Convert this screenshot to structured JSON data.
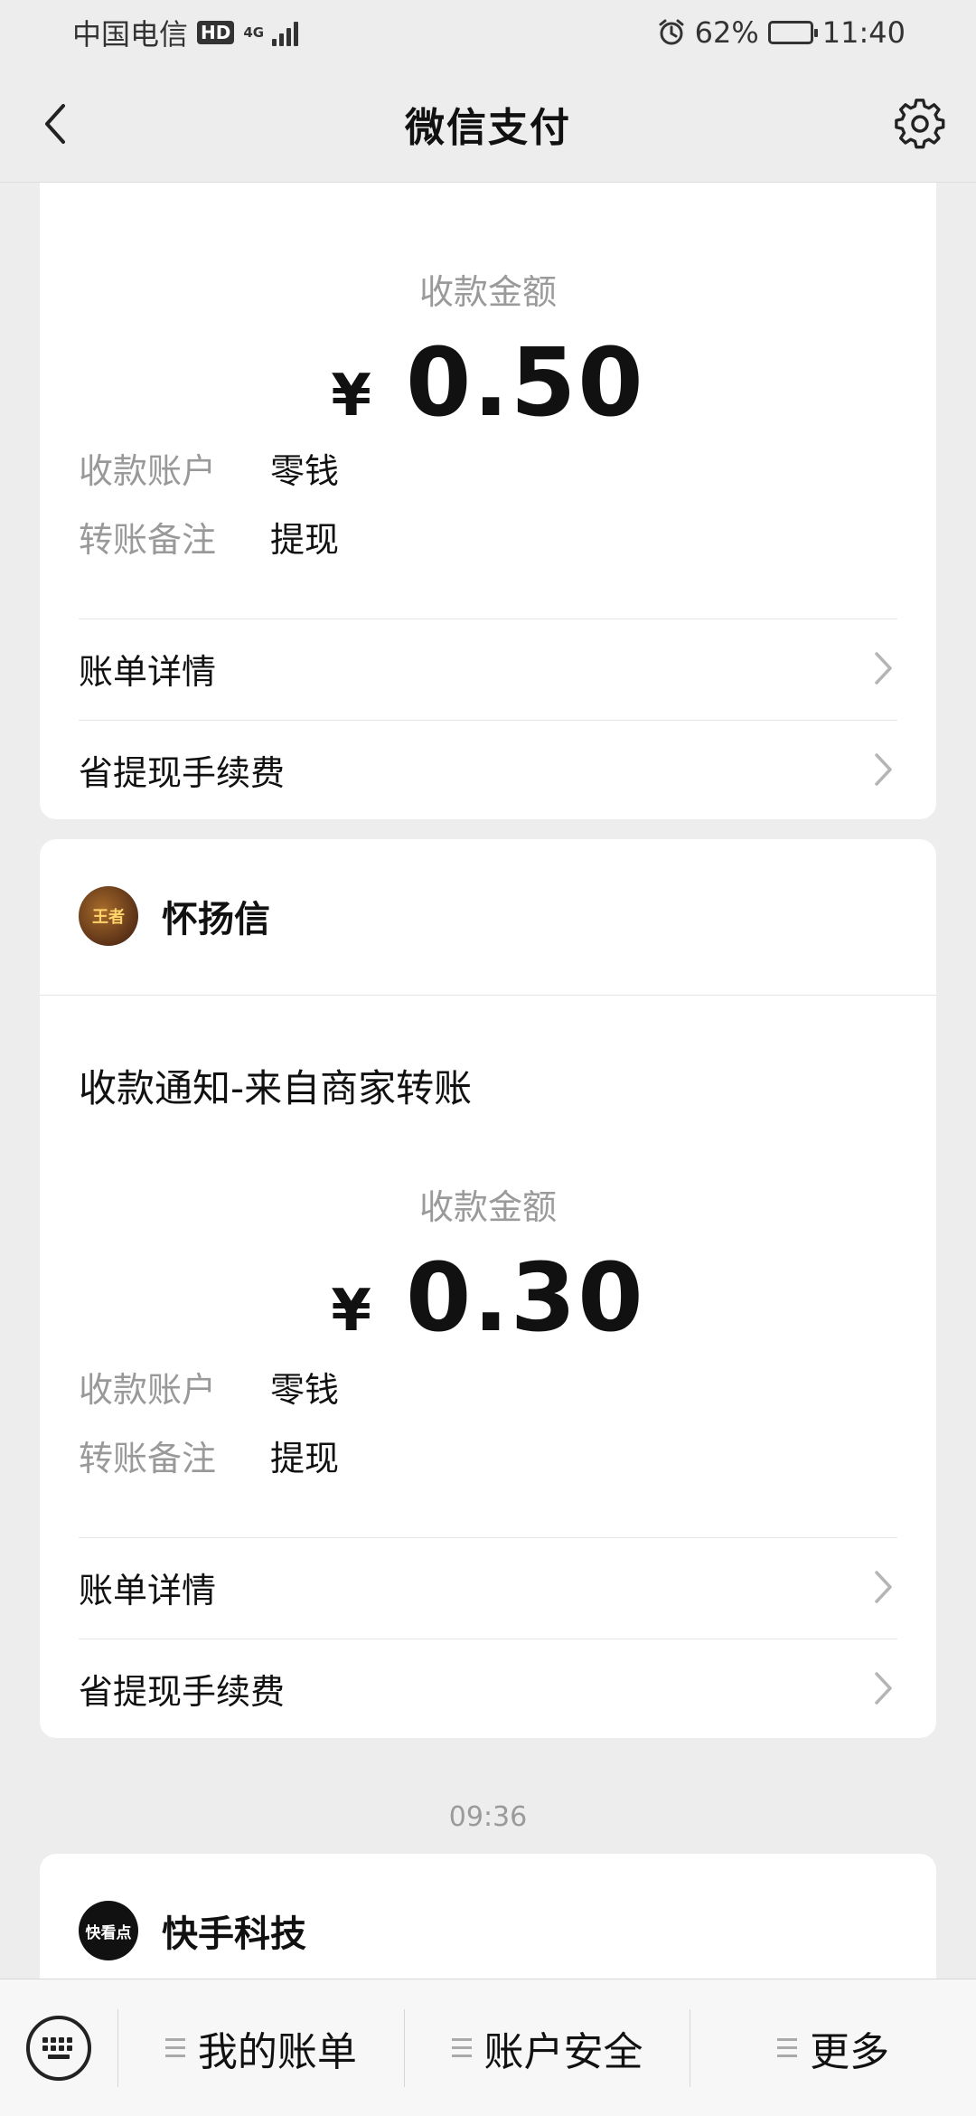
{
  "status_bar": {
    "carrier": "中国电信",
    "hd": "HD",
    "network": "4G",
    "battery_percent": "62%",
    "battery_level": 0.62,
    "time": "11:40"
  },
  "nav": {
    "title": "微信支付",
    "back_icon": "chevron-left-icon",
    "settings_icon": "gear-icon"
  },
  "cards": [
    {
      "amount_label": "收款金额",
      "currency": "¥",
      "amount": "0.50",
      "account_label": "收款账户",
      "account_value": "零钱",
      "remark_label": "转账备注",
      "remark_value": "提现",
      "links": [
        "账单详情",
        "省提现手续费"
      ]
    },
    {
      "merchant": "怀扬信",
      "avatar_text": "王者",
      "title": "收款通知-来自商家转账",
      "amount_label": "收款金额",
      "currency": "¥",
      "amount": "0.30",
      "account_label": "收款账户",
      "account_value": "零钱",
      "remark_label": "转账备注",
      "remark_value": "提现",
      "links": [
        "账单详情",
        "省提现手续费"
      ]
    }
  ],
  "timestamp": "09:36",
  "card3": {
    "merchant": "快手科技",
    "avatar_text": "快看点"
  },
  "bottom_menu": {
    "keyboard_icon": "keyboard-icon",
    "items": [
      "我的账单",
      "账户安全",
      "更多"
    ]
  }
}
